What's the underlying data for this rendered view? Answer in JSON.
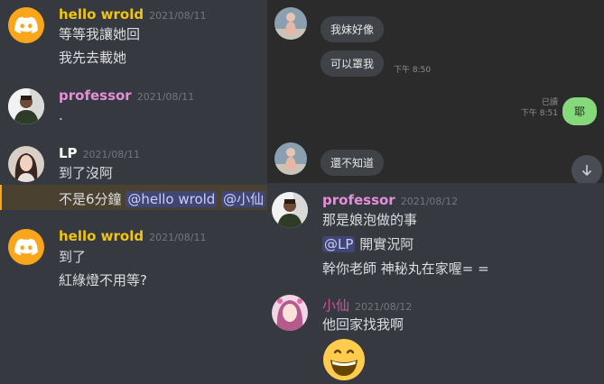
{
  "left_chat": {
    "messages": [
      {
        "username": "hello wrold",
        "timestamp": "2021/08/11",
        "lines": [
          "等等我讓她回",
          "我先去載她"
        ],
        "avatar": "discord-logo-icon"
      },
      {
        "username": "professor",
        "timestamp": "2021/08/11",
        "lines": [
          "."
        ],
        "avatar": "user-photo"
      },
      {
        "username": "LP",
        "timestamp": "2021/08/11",
        "lines": [
          "到了沒阿"
        ],
        "highlight": {
          "text": "不是6分鐘",
          "mentions": [
            "@hello wrold",
            "@小仙"
          ]
        }
      },
      {
        "username": "hello wrold",
        "timestamp": "2021/08/11",
        "lines": [
          "到了",
          "紅綠燈不用等?"
        ]
      }
    ]
  },
  "line_chat": {
    "incoming_1": [
      "我妹好像",
      "可以罩我"
    ],
    "incoming_1_time": "下午 8:50",
    "outgoing": {
      "text": "耶",
      "read": "已讀",
      "time": "下午 8:51"
    },
    "incoming_2": "還不知道",
    "scroll_icon": "arrow-down-icon"
  },
  "right_chat": {
    "messages": [
      {
        "username": "professor",
        "timestamp": "2021/08/12",
        "lines": [
          "那是娘泡做的事"
        ],
        "mention": "@LP",
        "mention_rest": "開實況阿",
        "line3": "幹你老師 神秘丸在家喔= ="
      },
      {
        "username": "小仙",
        "timestamp": "2021/08/12",
        "lines": [
          "他回家找我啊"
        ],
        "emoji": "grinning-face-emoji"
      }
    ]
  },
  "colors": {
    "hello_wrold": "#f1c40f",
    "professor": "#e58fd9",
    "lp": "#ffffff",
    "xiaoxian": "#c8579f",
    "line_green": "#86d97b"
  }
}
